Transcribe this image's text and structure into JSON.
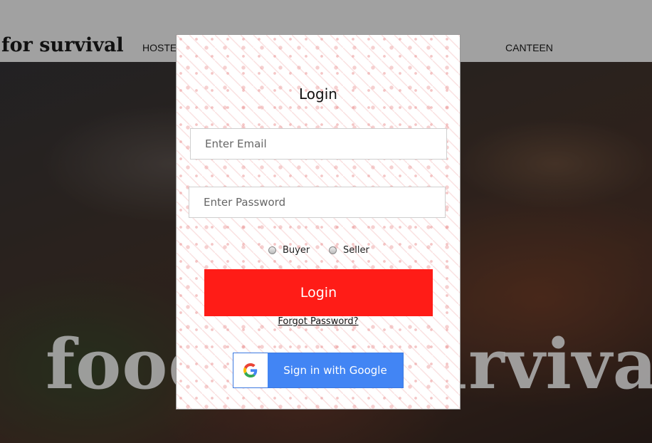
{
  "nav": {
    "brand": "for survival",
    "links": [
      "HOSTE",
      "CANTEEN"
    ]
  },
  "hero": {
    "title": "food for survival"
  },
  "login": {
    "title": "Login",
    "email_placeholder": "Enter Email",
    "password_placeholder": "Enter Password",
    "roles": [
      "Buyer",
      "Seller"
    ],
    "login_button": "Login",
    "forgot_link": "Forgot Password?",
    "google_button": "Sign in with Google"
  },
  "colors": {
    "accent": "#ff1c17",
    "google": "#4285f4"
  },
  "icons": {
    "google": "google-g-logo"
  }
}
